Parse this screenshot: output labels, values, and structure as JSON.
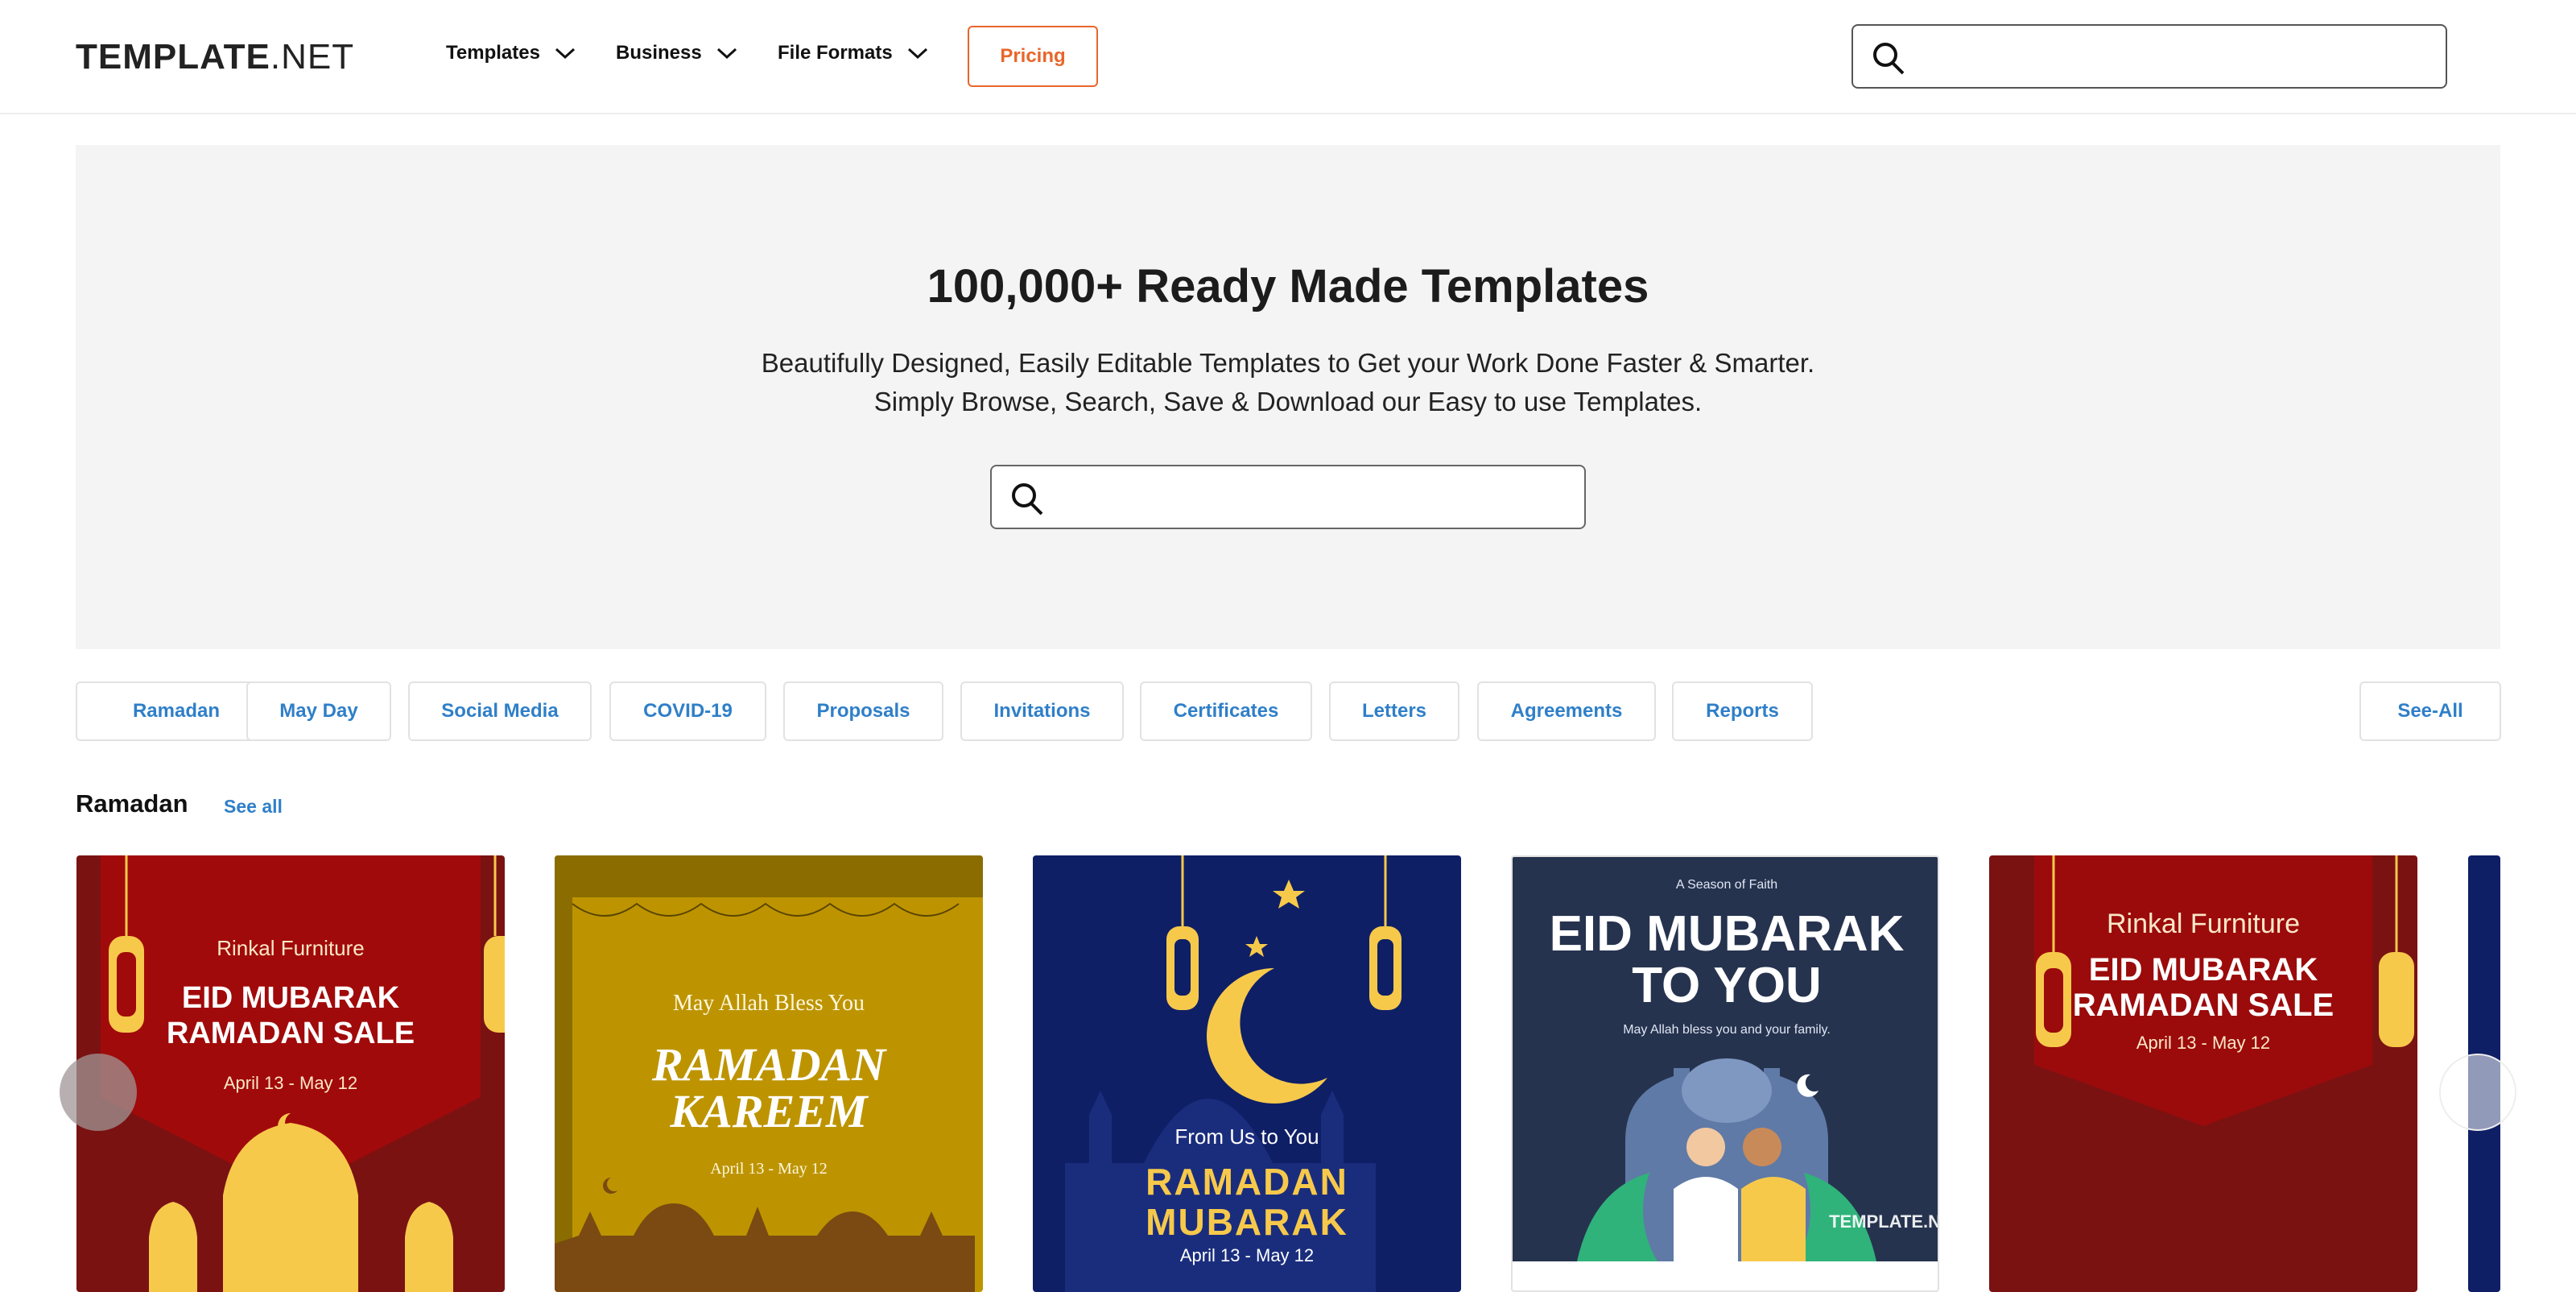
{
  "brand": {
    "logo_bold": "TEMPLATE",
    "logo_light": ".NET"
  },
  "nav": {
    "templates": "Templates",
    "business": "Business",
    "file_formats": "File Formats",
    "pricing": "Pricing"
  },
  "header_search": {
    "placeholder": ""
  },
  "hero": {
    "title": "100,000+ Ready Made Templates",
    "subtitle_line1": "Beautifully Designed, Easily Editable Templates to Get your Work Done Faster & Smarter.",
    "subtitle_line2": "Simply Browse, Search, Save & Download our Easy to use Templates.",
    "search_placeholder": ""
  },
  "categories": [
    "Ramadan",
    "May Day",
    "Social Media",
    "COVID-19",
    "Proposals",
    "Invitations",
    "Certificates",
    "Letters",
    "Agreements",
    "Reports"
  ],
  "see_all_pill": "See-All",
  "section": {
    "title": "Ramadan",
    "see_all": "See all"
  },
  "cards": [
    {
      "brand": "Rinkal Furniture",
      "line1": "EID MUBARAK",
      "line2": "RAMADAN SALE",
      "dates": "April 13 - May 12"
    },
    {
      "top": "May Allah Bless You",
      "line1": "RAMADAN",
      "line2": "KAREEM",
      "dates": "April 13 - May 12"
    },
    {
      "top": "From Us to You",
      "line1": "RAMADAN",
      "line2": "MUBARAK",
      "dates": "April 13 - May 12"
    },
    {
      "top": "A Season of Faith",
      "line1": "EID MUBARAK",
      "line2": "TO YOU",
      "sub": "May Allah bless you and your family.",
      "watermark": "TEMPLATE.N"
    },
    {
      "brand": "Rinkal Furniture",
      "line1": "EID MUBARAK",
      "line2": "RAMADAN SALE",
      "dates": "April 13 - May 12"
    }
  ],
  "colors": {
    "accent_orange": "#e8662b",
    "link_blue": "#2f7fc8",
    "card1_red": "#9b0b0b",
    "card2_gold": "#bd9400",
    "card3_navy": "#0f1f66",
    "card4_slate": "#26334f",
    "card5_red": "#8e0a0a"
  }
}
